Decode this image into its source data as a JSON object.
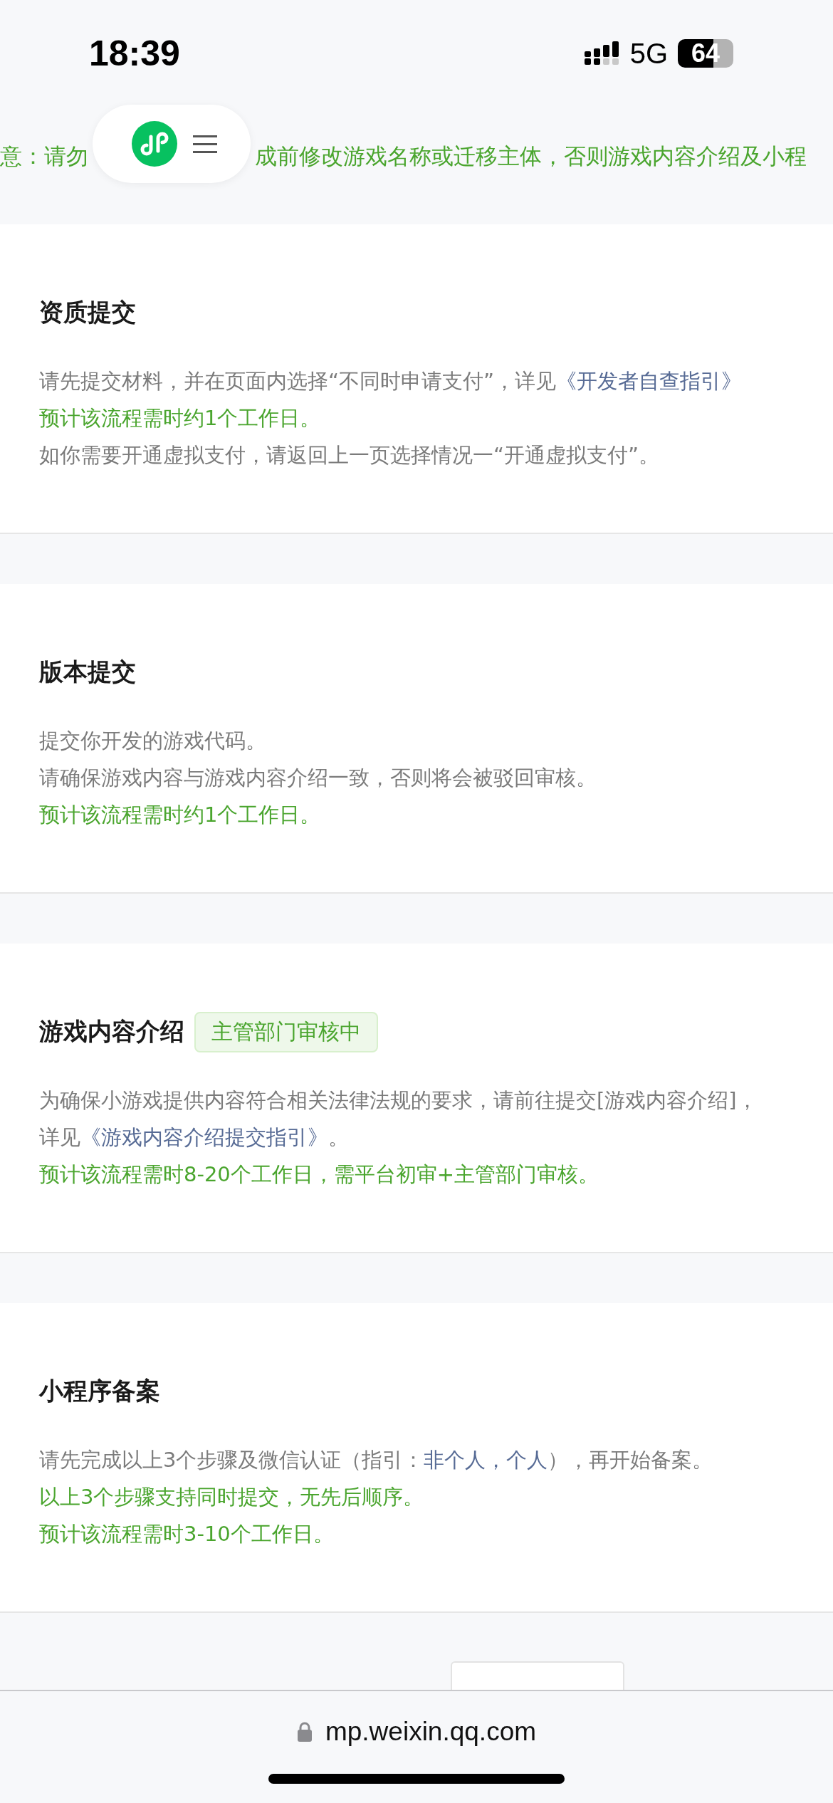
{
  "status_bar": {
    "time": "18:39",
    "network": "5G",
    "battery": "64"
  },
  "notice": {
    "before": "意：请勿",
    "after": "成前修改游戏名称或迁移主体，否则游戏内容介绍及小程"
  },
  "sections": [
    {
      "title": "资质提交",
      "lines": [
        [
          {
            "kind": "normal",
            "text": "请先提交材料，并在页面内选择“不同时申请支付”，详见"
          },
          {
            "kind": "link",
            "text": "《开发者自查指引》"
          }
        ],
        [
          {
            "kind": "green",
            "text": "预计该流程需时约1个工作日。"
          }
        ],
        [
          {
            "kind": "normal",
            "text": "如你需要开通虚拟支付，请返回上一页选择情况一“开通虚拟支付”。"
          }
        ]
      ]
    },
    {
      "title": "版本提交",
      "lines": [
        [
          {
            "kind": "normal",
            "text": "提交你开发的游戏代码。"
          }
        ],
        [
          {
            "kind": "normal",
            "text": "请确保游戏内容与游戏内容介绍一致，否则将会被驳回审核。"
          }
        ],
        [
          {
            "kind": "green",
            "text": "预计该流程需时约1个工作日。"
          }
        ]
      ]
    },
    {
      "title": "游戏内容介绍",
      "badge": "主管部门审核中",
      "lines": [
        [
          {
            "kind": "normal",
            "text": "为确保小游戏提供内容符合相关法律法规的要求，请前往提交[游戏内容介绍]，"
          }
        ],
        [
          {
            "kind": "normal",
            "text": "详见"
          },
          {
            "kind": "link",
            "text": "《游戏内容介绍提交指引》"
          },
          {
            "kind": "normal",
            "text": "。"
          }
        ],
        [
          {
            "kind": "green",
            "text": "预计该流程需时8-20个工作日，需平台初审+主管部门审核。"
          }
        ]
      ]
    },
    {
      "title": "小程序备案",
      "lines": [
        [
          {
            "kind": "normal",
            "text": "请先完成以上3个步骤及微信认证（指引："
          },
          {
            "kind": "link",
            "text": "非个人，"
          },
          {
            "kind": "link",
            "text": "个人"
          },
          {
            "kind": "normal",
            "text": "），再开始备案。"
          }
        ],
        [
          {
            "kind": "green",
            "text": "以上3个步骤支持同时提交，无先后顺序。"
          }
        ],
        [
          {
            "kind": "green",
            "text": "预计该流程需时3-10个工作日。"
          }
        ]
      ]
    }
  ],
  "address_bar": {
    "url": "mp.weixin.qq.com"
  }
}
